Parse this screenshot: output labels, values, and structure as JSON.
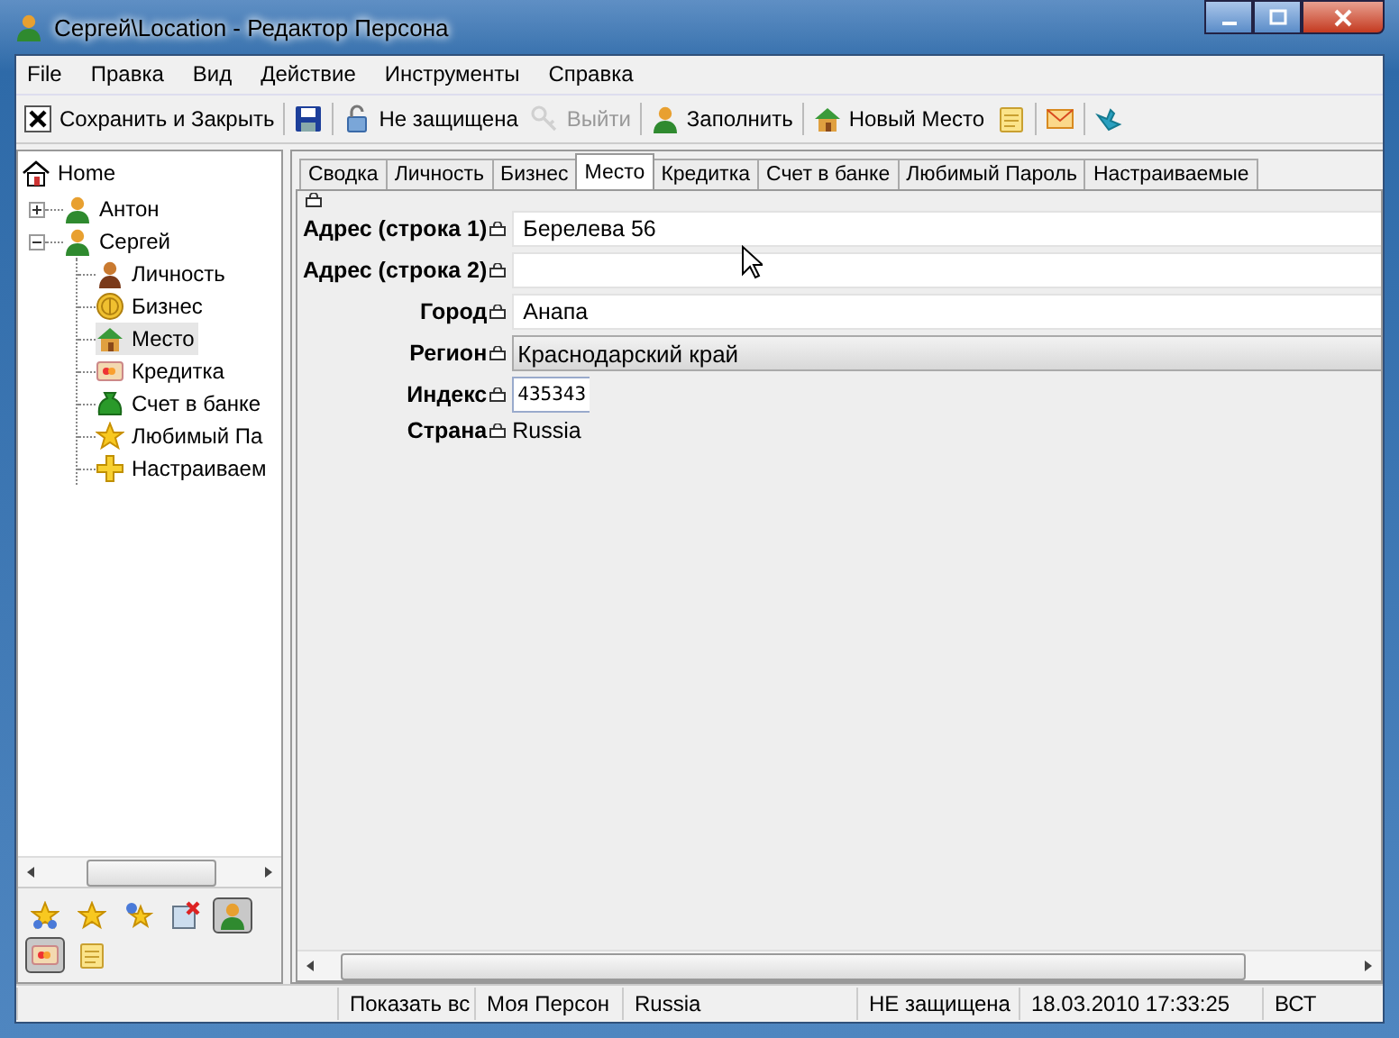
{
  "window": {
    "title": "Сергей\\Location - Редактор Персона"
  },
  "menu": [
    "File",
    "Правка",
    "Вид",
    "Действие",
    "Инструменты",
    "Справка"
  ],
  "toolbar": [
    {
      "label": "Сохранить и Закрыть",
      "disabled": false
    },
    {
      "disabled": false
    },
    {
      "label": "Не защищена",
      "disabled": false
    },
    {
      "label": "Выйти",
      "disabled": true
    },
    {
      "label": "Заполнить",
      "disabled": false
    },
    {
      "label": "Новый Место",
      "disabled": false
    },
    {
      "disabled": false
    },
    {
      "disabled": false
    },
    {
      "disabled": false
    }
  ],
  "tree": {
    "label": "Home",
    "children": [
      {
        "label": "Антон",
        "expanded": false,
        "selected": false
      },
      {
        "label": "Сергей",
        "expanded": true,
        "selected": false,
        "children": [
          {
            "label": "Личность",
            "selected": false
          },
          {
            "label": "Бизнес",
            "selected": false
          },
          {
            "label": "Место",
            "selected": true
          },
          {
            "label": "Кредитка",
            "selected": false
          },
          {
            "label": "Счет в банке",
            "selected": false
          },
          {
            "label": "Любимый Па",
            "selected": false
          },
          {
            "label": "Настраиваем",
            "selected": false
          }
        ]
      }
    ]
  },
  "bottom_tools": [
    {
      "pressed": false
    },
    {
      "pressed": false
    },
    {
      "pressed": false
    },
    {
      "pressed": false
    },
    {
      "pressed": true
    },
    {
      "pressed": true
    },
    {
      "pressed": false
    }
  ],
  "tabs": [
    {
      "label": "Сводка",
      "selected": false
    },
    {
      "label": "Личность",
      "selected": false
    },
    {
      "label": "Бизнес",
      "selected": false
    },
    {
      "label": "Место",
      "selected": true
    },
    {
      "label": "Кредитка",
      "selected": false
    },
    {
      "label": "Счет в банке",
      "selected": false
    },
    {
      "label": "Любимый Пароль",
      "selected": false
    },
    {
      "label": "Настраиваемые",
      "selected": false
    }
  ],
  "fields": [
    {
      "label": "Адрес (строка 1)",
      "kind": "text",
      "value": "Берелева 56"
    },
    {
      "label": "Адрес (строка 2)",
      "kind": "text"
    },
    {
      "label": "Город",
      "kind": "text",
      "value": "Анапа"
    },
    {
      "label": "Регион",
      "kind": "dropdown",
      "value": "Краснодарский край"
    },
    {
      "label": "Индекс",
      "kind": "short",
      "value": "435343"
    },
    {
      "label": "Страна",
      "kind": "plain",
      "value": "Russia"
    }
  ],
  "status_bar": [
    "Показать вс",
    "Моя Персон",
    "Russia",
    "НЕ защищена",
    "18.03.2010 17:33:25",
    "ВСТ"
  ]
}
